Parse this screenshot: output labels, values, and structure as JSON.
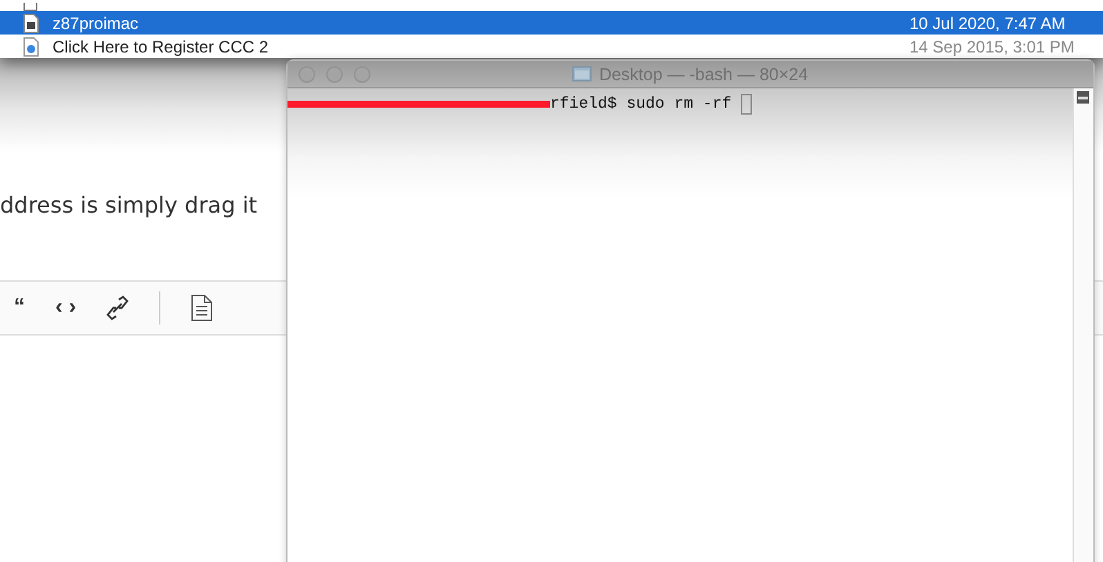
{
  "file_list": {
    "rows": [
      {
        "name": "z87proimac",
        "date": "10 Jul 2020, 7:47 AM",
        "kind": "disk",
        "selected": true
      },
      {
        "name": "Click Here to Register CCC 2",
        "date": "14 Sep 2015, 3:01 PM",
        "kind": "link",
        "selected": false
      }
    ]
  },
  "page": {
    "text": "ddress is simply drag it",
    "toolbar_glyphs": [
      "“",
      "‹ ›"
    ]
  },
  "terminal": {
    "title": "Desktop — -bash — 80×24",
    "line": "rfield$ sudo rm -rf"
  }
}
